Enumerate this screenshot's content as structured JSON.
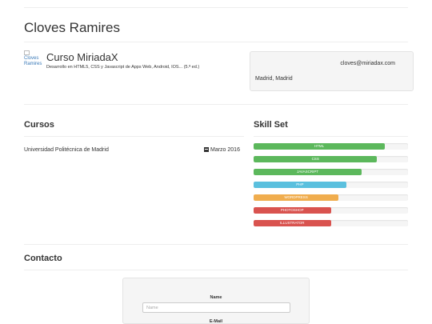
{
  "profile": {
    "name": "Cloves Ramires",
    "image_alt": "Cloves Ramires",
    "course_title": "Curso MiriadaX",
    "course_desc": "Desarrollo en HTML5, CSS y Javascript de Apps Web, Android, IOS... (5.ª ed.)",
    "email": "cloves@miriadax.com",
    "location": "Madrid, Madrid"
  },
  "sections": {
    "cursos": "Cursos",
    "skills": "Skill Set",
    "contacto": "Contacto"
  },
  "education": {
    "school": "Universidad Politécnica de Madrid",
    "date": "Marzo 2016",
    "date_icon": "calendar-icon"
  },
  "skills": [
    {
      "label": "HTML",
      "percent": 85,
      "color": "#5cb85c"
    },
    {
      "label": "CSS",
      "percent": 80,
      "color": "#5cb85c"
    },
    {
      "label": "JAVASCRIPT",
      "percent": 70,
      "color": "#5cb85c"
    },
    {
      "label": "PHP",
      "percent": 60,
      "color": "#5bc0de"
    },
    {
      "label": "WORDPRESS",
      "percent": 55,
      "color": "#f0ad4e"
    },
    {
      "label": "PHOTOSHOP",
      "percent": 50,
      "color": "#d9534f"
    },
    {
      "label": "ILLUSTRATOR",
      "percent": 50,
      "color": "#d9534f"
    }
  ],
  "form": {
    "name_label": "Name",
    "name_placeholder": "Name",
    "email_label": "E-Mail"
  }
}
